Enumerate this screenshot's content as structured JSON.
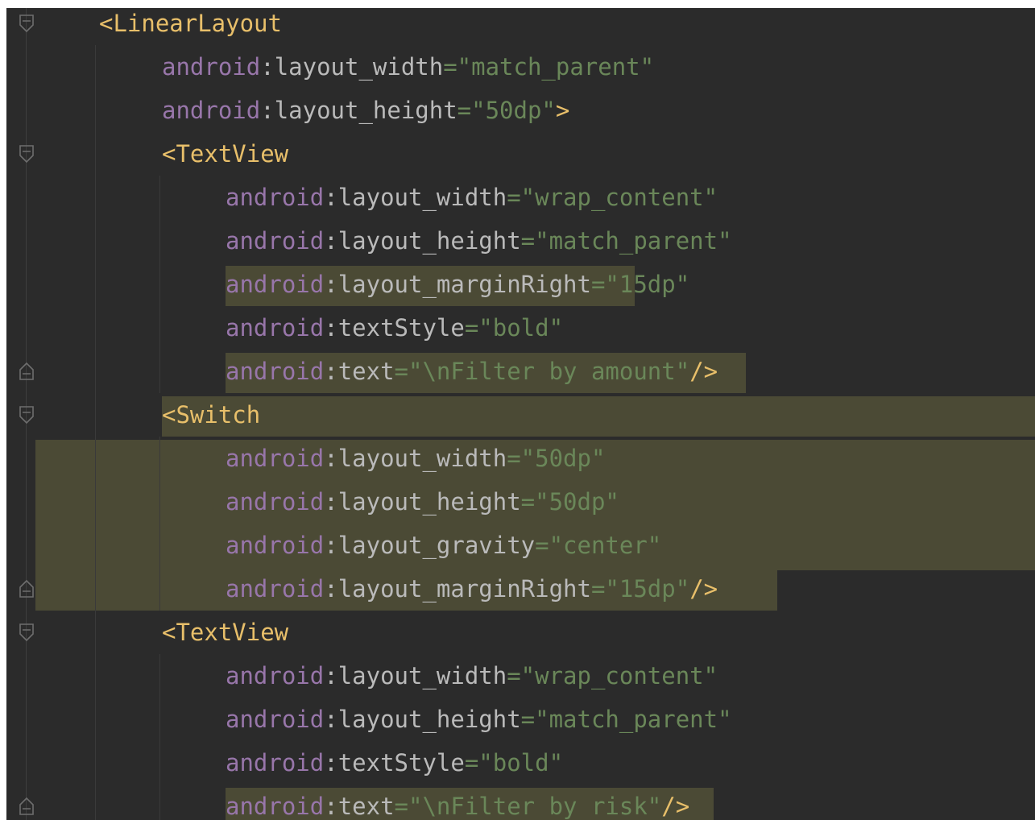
{
  "colors": {
    "background": "#2b2b2b",
    "tag": "#e8bf6a",
    "namespace": "#9876aa",
    "attribute": "#bababa",
    "value": "#6a8759",
    "highlight": "#4f4e37"
  },
  "code": {
    "lines": [
      {
        "indent": 1,
        "tokens": [
          {
            "t": "tag",
            "v": "<LinearLayout"
          }
        ]
      },
      {
        "indent": 2,
        "tokens": [
          {
            "t": "ns",
            "v": "android"
          },
          {
            "t": "colon",
            "v": ":"
          },
          {
            "t": "attr",
            "v": "layout_width"
          },
          {
            "t": "val",
            "v": "=\"match_parent\""
          }
        ]
      },
      {
        "indent": 2,
        "tokens": [
          {
            "t": "ns",
            "v": "android"
          },
          {
            "t": "colon",
            "v": ":"
          },
          {
            "t": "attr",
            "v": "layout_height"
          },
          {
            "t": "val",
            "v": "=\"50dp\""
          },
          {
            "t": "tag",
            "v": ">"
          }
        ]
      },
      {
        "indent": 2,
        "tokens": [
          {
            "t": "tag",
            "v": "<TextView"
          }
        ]
      },
      {
        "indent": 3,
        "tokens": [
          {
            "t": "ns",
            "v": "android"
          },
          {
            "t": "colon",
            "v": ":"
          },
          {
            "t": "attr",
            "v": "layout_width"
          },
          {
            "t": "val",
            "v": "=\"wrap_content\""
          }
        ]
      },
      {
        "indent": 3,
        "tokens": [
          {
            "t": "ns",
            "v": "android"
          },
          {
            "t": "colon",
            "v": ":"
          },
          {
            "t": "attr",
            "v": "layout_height"
          },
          {
            "t": "val",
            "v": "=\"match_parent\""
          }
        ]
      },
      {
        "indent": 3,
        "tokens": [
          {
            "t": "ns",
            "v": "android"
          },
          {
            "t": "colon",
            "v": ":"
          },
          {
            "t": "attr",
            "v": "layout_marginRight"
          },
          {
            "t": "val",
            "v": "=\"15dp\""
          }
        ]
      },
      {
        "indent": 3,
        "tokens": [
          {
            "t": "ns",
            "v": "android"
          },
          {
            "t": "colon",
            "v": ":"
          },
          {
            "t": "attr",
            "v": "textStyle"
          },
          {
            "t": "val",
            "v": "=\"bold\""
          }
        ]
      },
      {
        "indent": 3,
        "tokens": [
          {
            "t": "ns",
            "v": "android"
          },
          {
            "t": "colon",
            "v": ":"
          },
          {
            "t": "attr",
            "v": "text"
          },
          {
            "t": "val",
            "v": "=\"\\nFilter by amount\""
          },
          {
            "t": "tag",
            "v": "/>"
          }
        ]
      },
      {
        "indent": 2,
        "tokens": [
          {
            "t": "tag",
            "v": "<Switch"
          }
        ]
      },
      {
        "indent": 3,
        "tokens": [
          {
            "t": "ns",
            "v": "android"
          },
          {
            "t": "colon",
            "v": ":"
          },
          {
            "t": "attr",
            "v": "layout_width"
          },
          {
            "t": "val",
            "v": "=\"50dp\""
          }
        ]
      },
      {
        "indent": 3,
        "tokens": [
          {
            "t": "ns",
            "v": "android"
          },
          {
            "t": "colon",
            "v": ":"
          },
          {
            "t": "attr",
            "v": "layout_height"
          },
          {
            "t": "val",
            "v": "=\"50dp\""
          }
        ]
      },
      {
        "indent": 3,
        "tokens": [
          {
            "t": "ns",
            "v": "android"
          },
          {
            "t": "colon",
            "v": ":"
          },
          {
            "t": "attr",
            "v": "layout_gravity"
          },
          {
            "t": "val",
            "v": "=\"center\""
          }
        ]
      },
      {
        "indent": 3,
        "tokens": [
          {
            "t": "ns",
            "v": "android"
          },
          {
            "t": "colon",
            "v": ":"
          },
          {
            "t": "attr",
            "v": "layout_marginRight"
          },
          {
            "t": "val",
            "v": "=\"15dp\""
          },
          {
            "t": "tag",
            "v": "/>"
          }
        ]
      },
      {
        "indent": 2,
        "tokens": [
          {
            "t": "tag",
            "v": "<TextView"
          }
        ]
      },
      {
        "indent": 3,
        "tokens": [
          {
            "t": "ns",
            "v": "android"
          },
          {
            "t": "colon",
            "v": ":"
          },
          {
            "t": "attr",
            "v": "layout_width"
          },
          {
            "t": "val",
            "v": "=\"wrap_content\""
          }
        ]
      },
      {
        "indent": 3,
        "tokens": [
          {
            "t": "ns",
            "v": "android"
          },
          {
            "t": "colon",
            "v": ":"
          },
          {
            "t": "attr",
            "v": "layout_height"
          },
          {
            "t": "val",
            "v": "=\"match_parent\""
          }
        ]
      },
      {
        "indent": 3,
        "tokens": [
          {
            "t": "ns",
            "v": "android"
          },
          {
            "t": "colon",
            "v": ":"
          },
          {
            "t": "attr",
            "v": "textStyle"
          },
          {
            "t": "val",
            "v": "=\"bold\""
          }
        ]
      },
      {
        "indent": 3,
        "tokens": [
          {
            "t": "ns",
            "v": "android"
          },
          {
            "t": "colon",
            "v": ":"
          },
          {
            "t": "attr",
            "v": "text"
          },
          {
            "t": "val",
            "v": "=\"\\nFilter by risk\""
          },
          {
            "t": "tag",
            "v": "/>"
          }
        ]
      }
    ]
  }
}
